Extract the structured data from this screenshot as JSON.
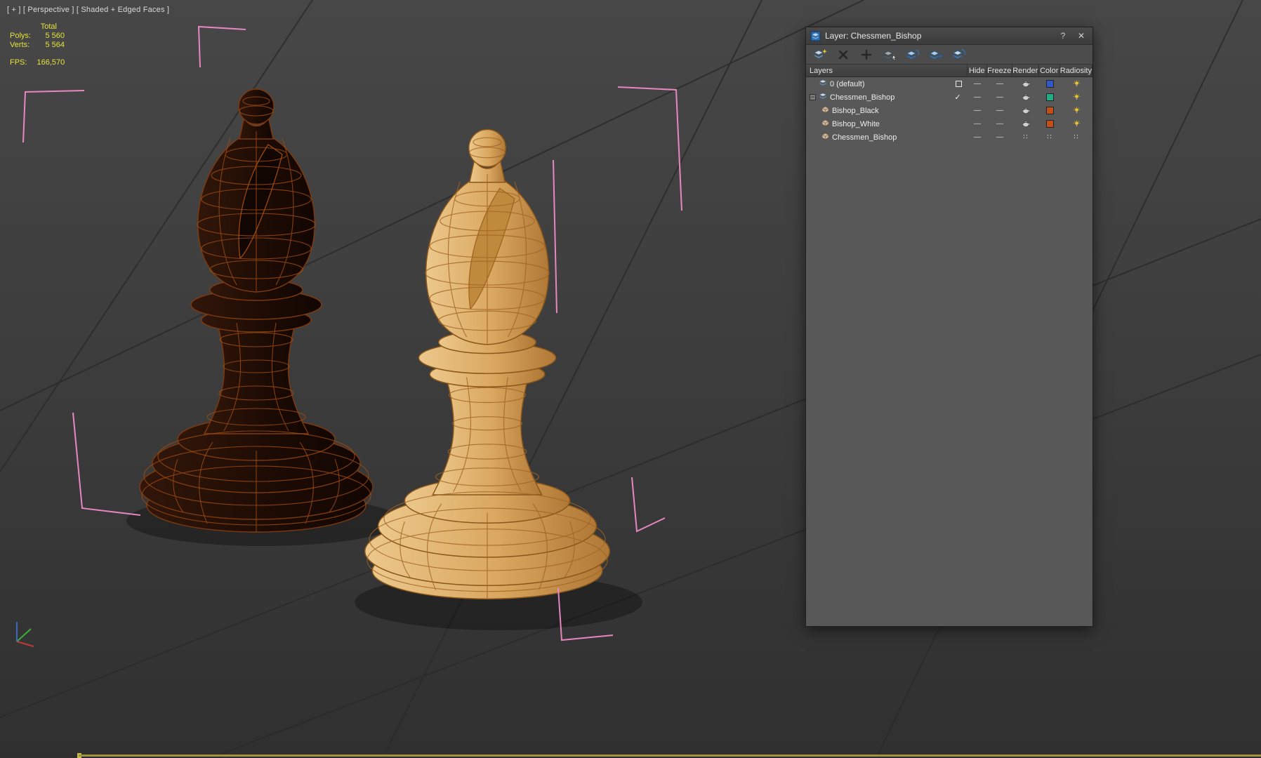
{
  "viewport": {
    "label": "[ + ] [ Perspective ] [ Shaded + Edged Faces ]",
    "stats": {
      "total_label": "Total",
      "polys_label": "Polys:",
      "polys_value": "5 560",
      "verts_label": "Verts:",
      "verts_value": "5 564",
      "fps_label": "FPS:",
      "fps_value": "166,570"
    },
    "colors": {
      "stats_text": "#e4e43c",
      "selection_bracket": "#f08bc8",
      "dark_piece_fill": "#220e06",
      "dark_piece_wire": "#a14c10",
      "light_piece_fill": "#d9a860",
      "light_piece_wire": "#a06423"
    }
  },
  "layer_dialog": {
    "title": "Layer: Chessmen_Bishop",
    "help_label": "?",
    "close_label": "✕",
    "toolbar_icons": [
      "create-new-layer-icon",
      "delete-layer-icon",
      "add-layer-icon",
      "add-selection-to-layer-icon",
      "select-objects-in-layer-icon",
      "set-current-layer-icon",
      "highlight-selected-layers-icon"
    ],
    "columns": [
      "Layers",
      "Hide",
      "Freeze",
      "Render",
      "Color",
      "Radiosity"
    ],
    "rows": [
      {
        "label": "0 (default)",
        "kind": "layer",
        "indent": 0,
        "current": false,
        "hide": "—",
        "freeze": "—",
        "render": "teapot",
        "color": "#3158c8",
        "radiosity": "lamp"
      },
      {
        "label": "Chessmen_Bishop",
        "kind": "layer",
        "indent": 0,
        "current": true,
        "expanded": true,
        "hide": "—",
        "freeze": "—",
        "render": "teapot",
        "color": "#1fae7f",
        "radiosity": "lamp"
      },
      {
        "label": "Bishop_Black",
        "kind": "object",
        "indent": 1,
        "hide": "—",
        "freeze": "—",
        "render": "teapot",
        "color": "#c05018",
        "radiosity": "lamp"
      },
      {
        "label": "Bishop_White",
        "kind": "object",
        "indent": 1,
        "hide": "—",
        "freeze": "—",
        "render": "teapot",
        "color": "#c05018",
        "radiosity": "lamp"
      },
      {
        "label": "Chessmen_Bishop",
        "kind": "object",
        "indent": 1,
        "hide": "—",
        "freeze": "—",
        "render": "dots",
        "color": "dots",
        "radiosity": "dots"
      }
    ]
  }
}
